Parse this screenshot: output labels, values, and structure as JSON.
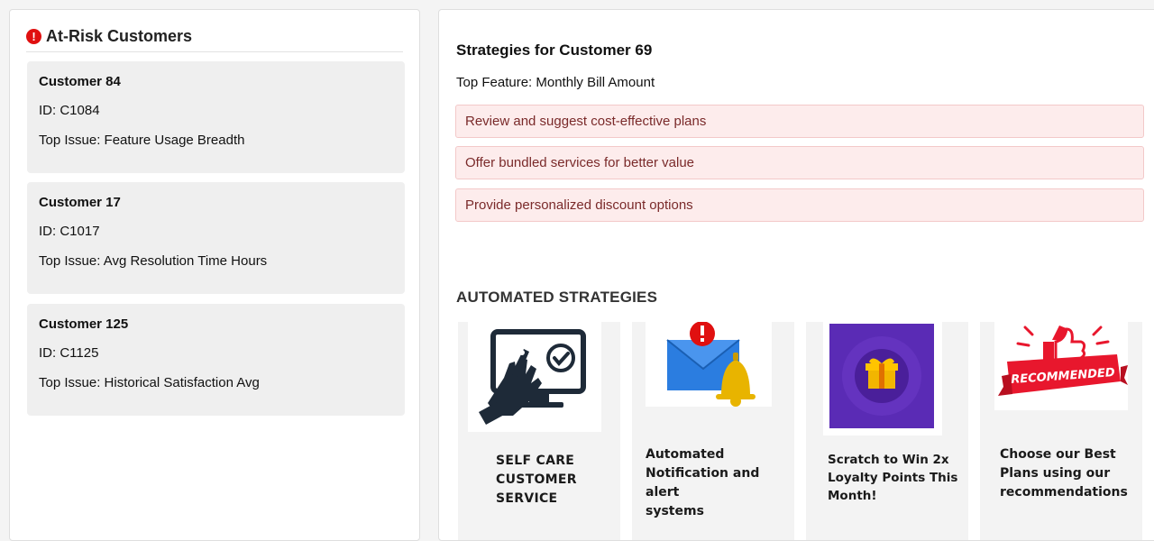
{
  "left": {
    "title": "At-Risk Customers",
    "alert_glyph": "!",
    "customers": [
      {
        "name": "Customer 84",
        "id": "ID: C1084",
        "issue": "Top Issue: Feature Usage Breadth"
      },
      {
        "name": "Customer 17",
        "id": "ID: C1017",
        "issue": "Top Issue: Avg Resolution Time Hours"
      },
      {
        "name": "Customer 125",
        "id": "ID: C1125",
        "issue": "Top Issue: Historical Satisfaction Avg"
      }
    ]
  },
  "right": {
    "title": "Strategies for Customer 69",
    "top_feature": "Top Feature: Monthly Bill Amount",
    "strategies": [
      "Review and suggest cost-effective plans",
      "Offer bundled services for better value",
      "Provide personalized discount options"
    ],
    "automated_title": "AUTOMATED STRATEGIES",
    "tiles": [
      {
        "icon": "self-care-touch-monitor-icon",
        "lines": [
          "SELF CARE",
          "CUSTOMER",
          "SERVICE"
        ]
      },
      {
        "icon": "notification-bell-envelope-icon",
        "lines": [
          "Automated",
          "Notification and alert",
          "systems"
        ]
      },
      {
        "icon": "scratch-card-gift-icon",
        "lines": [
          "Scratch to Win 2x",
          "Loyalty Points This",
          "Month!"
        ]
      },
      {
        "icon": "recommended-badge-icon",
        "badge_text": "RECOMMENDED",
        "lines": [
          "Choose our Best",
          "Plans using our",
          "recommendations"
        ]
      }
    ]
  },
  "colors": {
    "alert": "#e01010",
    "card_bg": "#efefef",
    "strategy_bg": "#fdecec",
    "strategy_text": "#7a2a2a",
    "scratch_purple": "#5a2bb5",
    "badge_red": "#e8172d"
  }
}
